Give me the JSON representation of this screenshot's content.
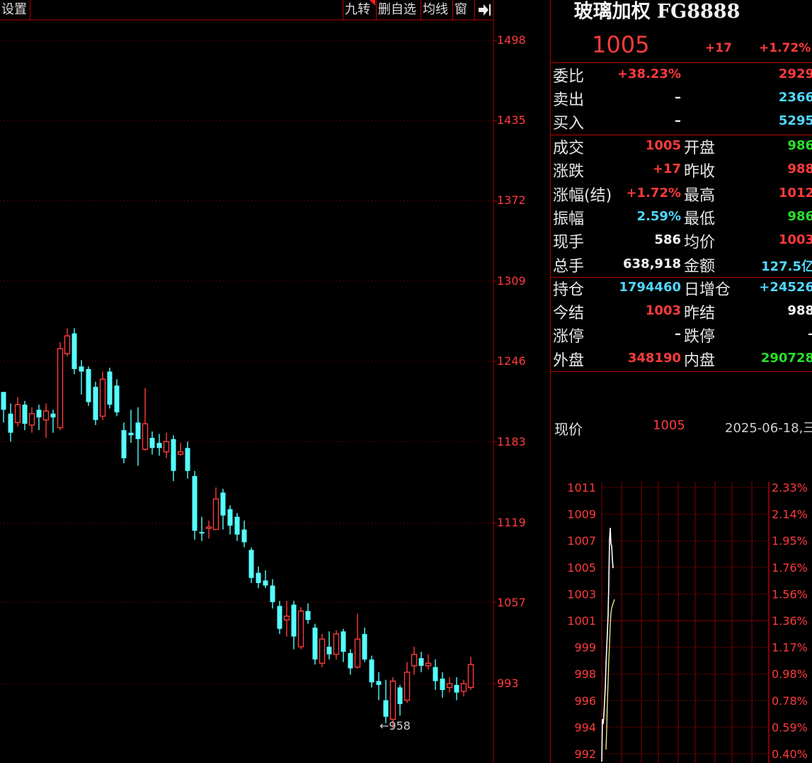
{
  "toolbar": {
    "settings": "设置",
    "nine_turn": "九转",
    "del_watch": "删自选",
    "ma": "均线",
    "window": "窗",
    "collapse_icon": "arrow-right-bar-icon"
  },
  "price_axis": {
    "ticks": [
      "1498",
      "1435",
      "1372",
      "1309",
      "1246",
      "1183",
      "1119",
      "1057",
      "993"
    ]
  },
  "low_marker": "←958",
  "panel": {
    "title": "玻璃加权 FG8888",
    "last_price": "1005",
    "change": "+17",
    "change_pct": "+1.72%",
    "bid_ask": [
      {
        "label": "委比",
        "v1": "+38.23%",
        "v2": "2929",
        "c1": "red",
        "c2": "red"
      },
      {
        "label": "卖出",
        "v1": "–",
        "v2": "2366",
        "c1": "white",
        "c2": "cyan"
      },
      {
        "label": "买入",
        "v1": "–",
        "v2": "5295",
        "c1": "white",
        "c2": "cyan"
      }
    ],
    "stats": [
      {
        "l1": "成交",
        "v1": "1005",
        "c1": "red",
        "l2": "开盘",
        "v2": "986",
        "c2": "green"
      },
      {
        "l1": "涨跌",
        "v1": "+17",
        "c1": "red",
        "l2": "昨收",
        "v2": "988",
        "c2": "red"
      },
      {
        "l1": "涨幅(结)",
        "v1": "+1.72%",
        "c1": "red",
        "l2": "最高",
        "v2": "1012",
        "c2": "red"
      },
      {
        "l1": "振幅",
        "v1": "2.59%",
        "c1": "cyan",
        "l2": "最低",
        "v2": "986",
        "c2": "green"
      },
      {
        "l1": "现手",
        "v1": "586",
        "c1": "white",
        "l2": "均价",
        "v2": "1003",
        "c2": "red"
      },
      {
        "l1": "总手",
        "v1": "638,918",
        "c1": "white",
        "l2": "金额",
        "v2": "127.5亿",
        "c2": "cyan"
      },
      {
        "l1": "持仓",
        "v1": "1794460",
        "c1": "cyan",
        "l2": "日增仓",
        "v2": "+24526",
        "c2": "cyan"
      },
      {
        "l1": "今结",
        "v1": "1003",
        "c1": "red",
        "l2": "昨结",
        "v2": "988",
        "c2": "white"
      },
      {
        "l1": "涨停",
        "v1": "–",
        "c1": "white",
        "l2": "跌停",
        "v2": "–",
        "c2": "white"
      },
      {
        "l1": "外盘",
        "v1": "348190",
        "c1": "red",
        "l2": "内盘",
        "v2": "290728",
        "c2": "green"
      }
    ],
    "tick": {
      "label": "现价",
      "price": "1005",
      "date": "2025-06-18,三"
    },
    "mini_left": [
      "1011",
      "1009",
      "1007",
      "1005",
      "1003",
      "1001",
      "999",
      "998",
      "996",
      "994",
      "992"
    ],
    "mini_right": [
      "2.33%",
      "2.14%",
      "1.95%",
      "1.76%",
      "1.56%",
      "1.36%",
      "1.17%",
      "0.98%",
      "0.78%",
      "0.59%",
      "0.40%"
    ]
  },
  "colors": {
    "up": "#ff3b3b",
    "down": "#54ffff",
    "grid": "#b00000"
  },
  "chart_data": {
    "type": "candlestick",
    "ylim": [
      958,
      1520
    ],
    "candles": [
      [
        1222,
        1208,
        1222,
        1198
      ],
      [
        1205,
        1190,
        1213,
        1183
      ],
      [
        1198,
        1212,
        1218,
        1195
      ],
      [
        1212,
        1197,
        1215,
        1192
      ],
      [
        1196,
        1205,
        1210,
        1190
      ],
      [
        1208,
        1202,
        1212,
        1192
      ],
      [
        1200,
        1207,
        1213,
        1186
      ],
      [
        1205,
        1202,
        1208,
        1190
      ],
      [
        1194,
        1256,
        1261,
        1192
      ],
      [
        1252,
        1266,
        1272,
        1250
      ],
      [
        1268,
        1240,
        1272,
        1236
      ],
      [
        1242,
        1238,
        1247,
        1220
      ],
      [
        1240,
        1214,
        1242,
        1211
      ],
      [
        1226,
        1200,
        1230,
        1196
      ],
      [
        1203,
        1232,
        1238,
        1200
      ],
      [
        1238,
        1212,
        1241,
        1209
      ],
      [
        1227,
        1206,
        1232,
        1203
      ],
      [
        1192,
        1170,
        1198,
        1166
      ],
      [
        1190,
        1188,
        1208,
        1182
      ],
      [
        1198,
        1185,
        1210,
        1164
      ],
      [
        1177,
        1197,
        1225,
        1176
      ],
      [
        1186,
        1178,
        1191,
        1173
      ],
      [
        1182,
        1178,
        1189,
        1172
      ],
      [
        1175,
        1183,
        1190,
        1170
      ],
      [
        1185,
        1160,
        1188,
        1152
      ],
      [
        1173,
        1175,
        1182,
        1172
      ],
      [
        1178,
        1160,
        1183,
        1154
      ],
      [
        1156,
        1113,
        1160,
        1106
      ],
      [
        1112,
        1111,
        1124,
        1105
      ],
      [
        1115,
        1116,
        1121,
        1107
      ],
      [
        1114,
        1138,
        1147,
        1114
      ],
      [
        1143,
        1125,
        1146,
        1114
      ],
      [
        1130,
        1117,
        1133,
        1110
      ],
      [
        1124,
        1110,
        1127,
        1105
      ],
      [
        1114,
        1104,
        1121,
        1100
      ],
      [
        1098,
        1076,
        1100,
        1072
      ],
      [
        1080,
        1072,
        1085,
        1068
      ],
      [
        1074,
        1070,
        1082,
        1068
      ],
      [
        1070,
        1057,
        1075,
        1052
      ],
      [
        1054,
        1036,
        1058,
        1032
      ],
      [
        1043,
        1046,
        1058,
        1030
      ],
      [
        1055,
        1030,
        1058,
        1020
      ],
      [
        1022,
        1050,
        1053,
        1020
      ],
      [
        1050,
        1043,
        1056,
        1040
      ],
      [
        1037,
        1012,
        1040,
        1008
      ],
      [
        1009,
        1028,
        1032,
        1006
      ],
      [
        1022,
        1016,
        1034,
        1012
      ],
      [
        1016,
        1032,
        1035,
        1012
      ],
      [
        1034,
        1018,
        1036,
        1010
      ],
      [
        1017,
        1005,
        1020,
        1000
      ],
      [
        1006,
        1028,
        1048,
        1005
      ],
      [
        1032,
        1012,
        1037,
        1010
      ],
      [
        1012,
        994,
        1015,
        990
      ],
      [
        995,
        992,
        1002,
        980
      ],
      [
        980,
        967,
        996,
        962
      ],
      [
        965,
        995,
        998,
        958
      ],
      [
        990,
        977,
        992,
        968
      ],
      [
        980,
        1002,
        1010,
        978
      ],
      [
        1007,
        1016,
        1022,
        1000
      ],
      [
        1013,
        1007,
        1018,
        1002
      ],
      [
        1007,
        1009,
        1016,
        1004
      ],
      [
        1006,
        995,
        1012,
        988
      ],
      [
        997,
        988,
        1002,
        982
      ],
      [
        990,
        993,
        998,
        986
      ],
      [
        992,
        986,
        998,
        980
      ],
      [
        987,
        993,
        996,
        983
      ],
      [
        990,
        1008,
        1014,
        988
      ]
    ]
  }
}
